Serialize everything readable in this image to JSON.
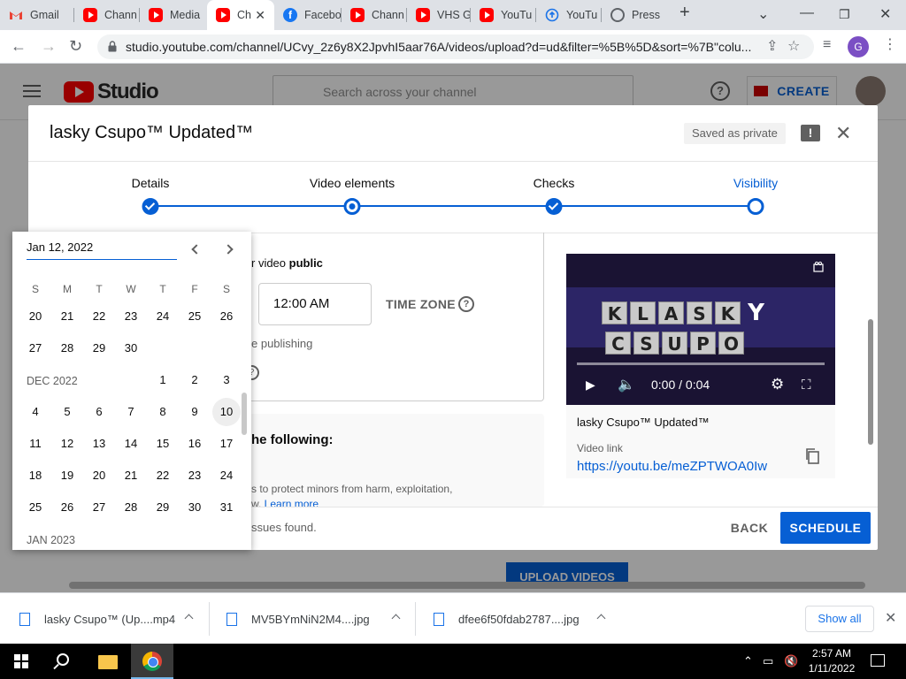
{
  "browser": {
    "tabs": [
      {
        "label": "Gmail",
        "icon": "gmail-icon"
      },
      {
        "label": "Chann",
        "icon": "youtube-icon"
      },
      {
        "label": "Media",
        "icon": "youtube-icon"
      },
      {
        "label": "Ch",
        "icon": "youtube-icon",
        "active": true
      },
      {
        "label": "Facebo",
        "icon": "facebook-icon"
      },
      {
        "label": "Chann",
        "icon": "youtube-icon"
      },
      {
        "label": "VHS G",
        "icon": "youtube-icon"
      },
      {
        "label": "YouTu",
        "icon": "youtube-icon"
      },
      {
        "label": "YouTu",
        "icon": "youtube-upload-icon"
      },
      {
        "label": "Press",
        "icon": "globe-icon"
      }
    ],
    "url": "studio.youtube.com/channel/UCvy_2z6y8X2JpvhI5aar76A/videos/upload?d=ud&filter=%5B%5D&sort=%7B\"colu...",
    "profile_initial": "G"
  },
  "studio": {
    "logo_text": "Studio",
    "search_placeholder": "Search across your channel",
    "create_label": "CREATE",
    "upload_videos_label": "UPLOAD VIDEOS"
  },
  "dialog": {
    "title": "lasky Csupo™ Updated™",
    "saved_status": "Saved as private",
    "steps": [
      {
        "label": "Details",
        "state": "done"
      },
      {
        "label": "Video elements",
        "state": "open"
      },
      {
        "label": "Checks",
        "state": "done"
      },
      {
        "label": "Visibility",
        "state": "current"
      }
    ],
    "schedule_text_prefix": "r video ",
    "schedule_text_bold": "public",
    "time_value": "12:00 AM",
    "time_zone_label": "TIME ZONE",
    "premiere_text": "e publishing",
    "checks_title": "he following:",
    "checks_desc": "s to protect minors from harm, exploitation,",
    "checks_learn_prefix": "w. ",
    "learn_more": "Learn more",
    "no_issues": "ssues found.",
    "back_label": "BACK",
    "schedule_label": "SCHEDULE",
    "preview": {
      "logo_letters_row1": [
        "K",
        "L",
        "A",
        "S",
        "K",
        "Y"
      ],
      "logo_letters_row2": [
        "C",
        "S",
        "U",
        "P",
        "O"
      ],
      "time": "0:00 / 0:04",
      "video_title": "lasky Csupo™ Updated™",
      "video_link_label": "Video link",
      "video_link": "https://youtu.be/meZPTWOA0Iw"
    }
  },
  "datepicker": {
    "input_value": "Jan 12, 2022",
    "weekdays": [
      "S",
      "M",
      "T",
      "W",
      "T",
      "F",
      "S"
    ],
    "nov_rows": [
      [
        "20",
        "21",
        "22",
        "23",
        "24",
        "25",
        "26"
      ],
      [
        "27",
        "28",
        "29",
        "30"
      ]
    ],
    "dec_label": "DEC 2022",
    "dec_rows": [
      [
        "1",
        "2",
        "3"
      ],
      [
        "4",
        "5",
        "6",
        "7",
        "8",
        "9",
        "10"
      ],
      [
        "11",
        "12",
        "13",
        "14",
        "15",
        "16",
        "17"
      ],
      [
        "18",
        "19",
        "20",
        "21",
        "22",
        "23",
        "24"
      ],
      [
        "25",
        "26",
        "27",
        "28",
        "29",
        "30",
        "31"
      ]
    ],
    "jan_label": "JAN 2023",
    "highlighted_day": "10"
  },
  "downloads": {
    "items": [
      {
        "label": "lasky Csupo™ (Up....mp4"
      },
      {
        "label": "MV5BYmNiN2M4....jpg"
      },
      {
        "label": "dfee6f50fdab2787....jpg"
      }
    ],
    "show_all_label": "Show all"
  },
  "taskbar": {
    "time": "2:57 AM",
    "date": "1/11/2022"
  },
  "colors": {
    "accent_blue": "#065fd4",
    "youtube_red": "#ff0000"
  }
}
